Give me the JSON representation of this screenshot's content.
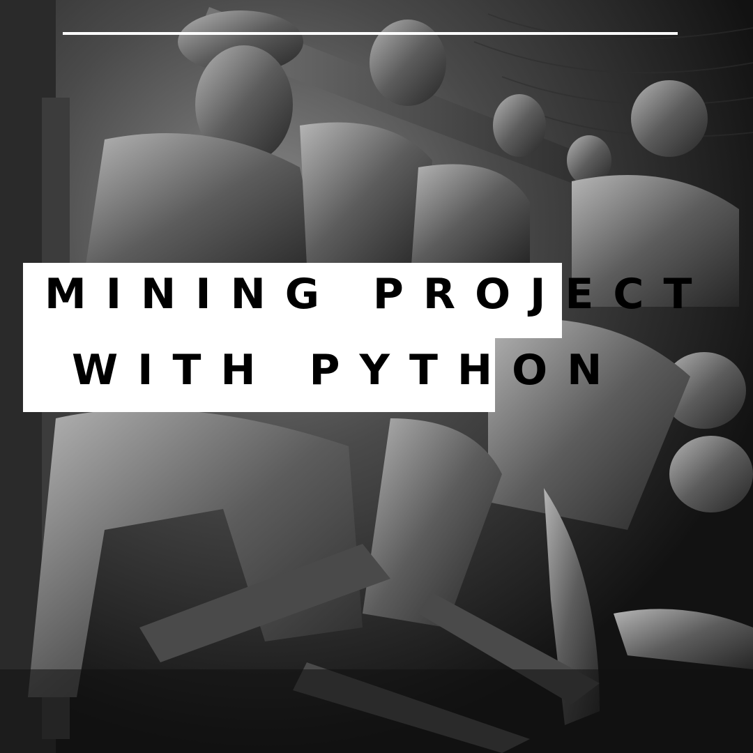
{
  "title": {
    "line1": "MINING PROJECT",
    "line2": "WITH PYTHON"
  },
  "colors": {
    "rule": "#ffffff",
    "title_box": "#ffffff",
    "title_text": "#000000",
    "photo_base": "#2a2a2a"
  }
}
